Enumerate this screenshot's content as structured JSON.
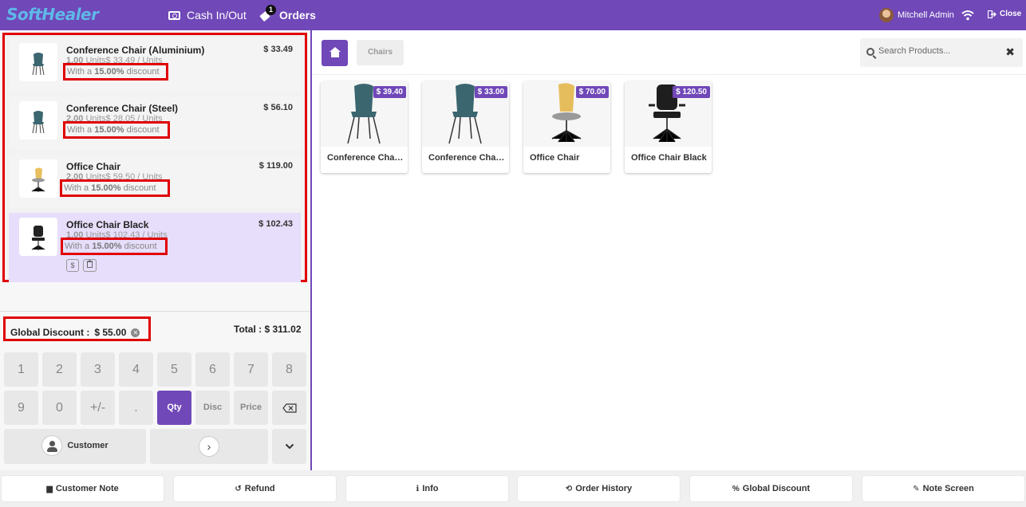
{
  "topbar": {
    "logo": "SoftHealer",
    "cash_label": "Cash In/Out",
    "orders_label": "Orders",
    "orders_count": "1",
    "user_name": "Mitchell Admin",
    "close_label": "Close"
  },
  "orderlines": [
    {
      "name": "Conference Chair (Aluminium)",
      "price": "$ 33.49",
      "qty": "1.00",
      "unit_info": "Units$ 33.49 / Units",
      "disc_prefix": "With a ",
      "disc_value": "15.00%",
      "disc_suffix": " discount"
    },
    {
      "name": "Conference Chair (Steel)",
      "price": "$ 56.10",
      "qty": "2.00",
      "unit_info": "Units$ 28.05 / Units",
      "disc_prefix": "With a ",
      "disc_value": "15.00%",
      "disc_suffix": " discount"
    },
    {
      "name": "Office Chair",
      "price": "$ 119.00",
      "qty": "2.00",
      "unit_info": "Units$ 59.50 / Units",
      "disc_prefix": "With a ",
      "disc_value": "15.00%",
      "disc_suffix": " discount"
    },
    {
      "name": "Office Chair Black",
      "price": "$ 102.43",
      "qty": "1.00",
      "unit_info": "Units$ 102.43 / Units",
      "disc_prefix": "With a ",
      "disc_value": "15.00%",
      "disc_suffix": " discount"
    }
  ],
  "selected_line": {
    "dollar_btn": "$",
    "trash_btn": "🗑"
  },
  "summary": {
    "global_discount_label": "Global Discount :",
    "global_discount_value": "$ 55.00",
    "total_label": "Total : $ 311.02"
  },
  "numpad": {
    "row1": [
      "1",
      "2",
      "3",
      "4",
      "5",
      "6",
      "7",
      "8"
    ],
    "row2": [
      "9",
      "0",
      "+/-",
      ".",
      "Qty",
      "Disc",
      "Price",
      "⌫"
    ],
    "customer_label": "Customer",
    "next_label": "›",
    "more_label": "⌄"
  },
  "right": {
    "category": "Chairs",
    "search_placeholder": "Search Products...",
    "clear": "✖"
  },
  "products": [
    {
      "name": "Conference Chair (Aluminium)",
      "price": "$ 39.40"
    },
    {
      "name": "Conference Chair (Steel)",
      "price": "$ 33.00"
    },
    {
      "name": "Office Chair",
      "price": "$ 70.00"
    },
    {
      "name": "Office Chair Black",
      "price": "$ 120.50"
    }
  ],
  "actions": [
    {
      "label": "Customer Note",
      "icon": "▆"
    },
    {
      "label": "Refund",
      "icon": "↺"
    },
    {
      "label": "Info",
      "icon": "ℹ"
    },
    {
      "label": "Order History",
      "icon": "⟲"
    },
    {
      "label": "Global Discount",
      "icon": "%"
    },
    {
      "label": "Note Screen",
      "icon": "✎"
    }
  ],
  "colors": {
    "brand": "#7048b8",
    "highlight": "#e00000",
    "selected_line": "#e6defa"
  }
}
